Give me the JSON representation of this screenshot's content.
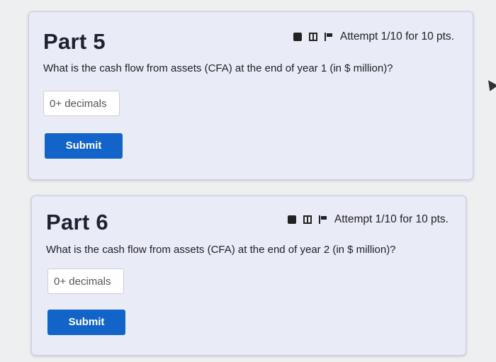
{
  "parts": [
    {
      "title": "Part 5",
      "attempt": "Attempt 1/10 for 10 pts.",
      "question": "What is the cash flow from assets (CFA) at the end of year 1 (in $ million)?",
      "input_placeholder": "0+ decimals",
      "input_value": "",
      "submit_label": "Submit"
    },
    {
      "title": "Part 6",
      "attempt": "Attempt 1/10 for 10 pts.",
      "question": "What is the cash flow from assets (CFA) at the end of year 2 (in $ million)?",
      "input_placeholder": "0+ decimals",
      "input_value": "",
      "submit_label": "Submit"
    }
  ],
  "icons": [
    "notepad-icon",
    "video-icon",
    "flag-icon"
  ],
  "colors": {
    "submit": "#1264c9",
    "card": "#e9ebf7"
  }
}
